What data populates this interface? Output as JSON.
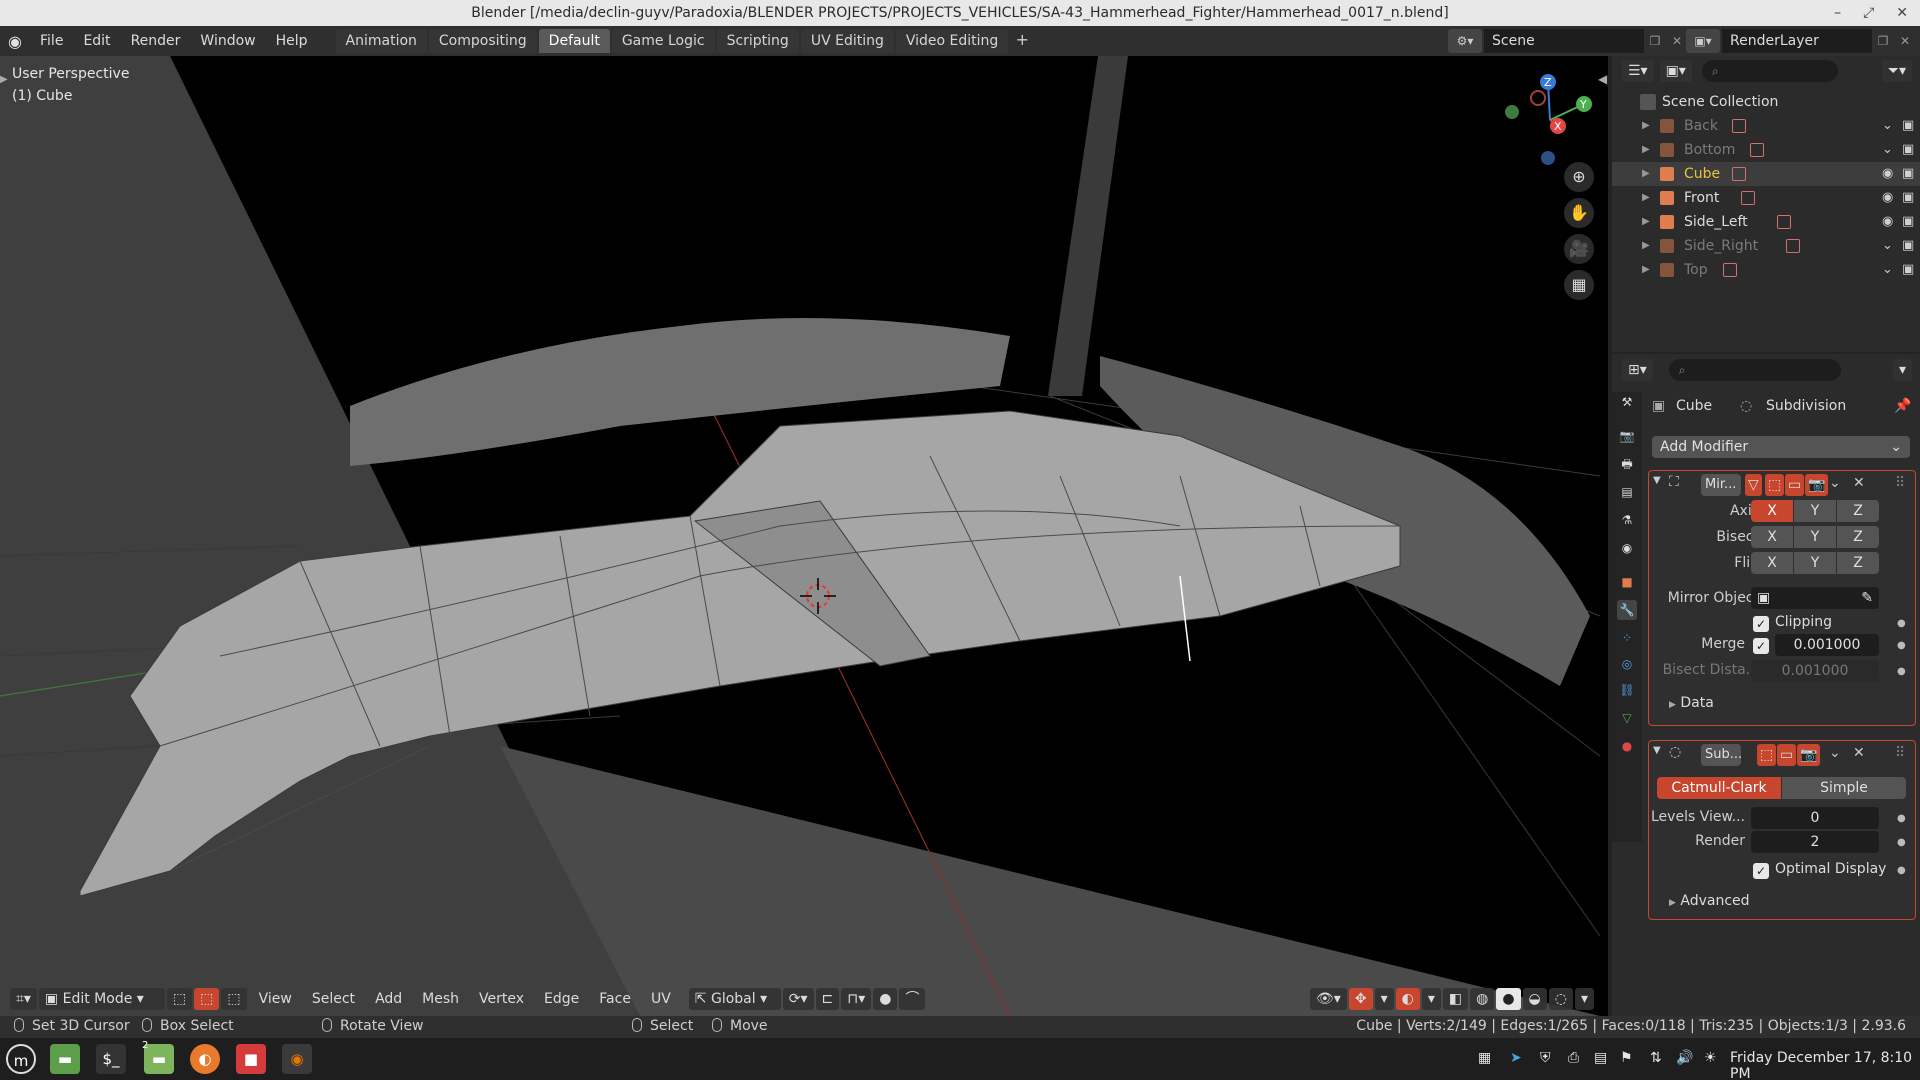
{
  "window": {
    "title": "Blender [/media/declin-guyv/Paradoxia/BLENDER PROJECTS/PROJECTS_VEHICLES/SA-43_Hammerhead_Fighter/Hammerhead_0017_n.blend]",
    "controls": [
      "–",
      "⤢",
      "✕"
    ]
  },
  "menu": [
    "File",
    "Edit",
    "Render",
    "Window",
    "Help"
  ],
  "workspaces": [
    {
      "label": "Animation",
      "active": false
    },
    {
      "label": "Compositing",
      "active": false
    },
    {
      "label": "Default",
      "active": true
    },
    {
      "label": "Game Logic",
      "active": false
    },
    {
      "label": "Scripting",
      "active": false
    },
    {
      "label": "UV Editing",
      "active": false
    },
    {
      "label": "Video Editing",
      "active": false
    }
  ],
  "scene": {
    "name": "Scene"
  },
  "render_layer": {
    "name": "RenderLayer"
  },
  "viewport": {
    "perspective": "User Perspective",
    "object": "(1) Cube",
    "gizmo": {
      "x": "X",
      "y": "Y",
      "z": "Z"
    }
  },
  "vp_header": {
    "mode": "Edit Mode",
    "menus": [
      "View",
      "Select",
      "Add",
      "Mesh",
      "Vertex",
      "Edge",
      "Face",
      "UV"
    ],
    "orientation": "Global"
  },
  "status": {
    "left": [
      "Set 3D Cursor",
      "Box Select",
      "Rotate View",
      "Select",
      "Move"
    ],
    "stats": "Cube | Verts:2/149 | Edges:1/265 | Faces:0/118 | Tris:235 | Objects:1/3 | 2.93.6"
  },
  "outliner": {
    "root": "Scene Collection",
    "items": [
      {
        "name": "Back",
        "visible": false,
        "selected": false,
        "color": "#7a7a7a"
      },
      {
        "name": "Bottom",
        "visible": false,
        "selected": false,
        "color": "#7a7a7a"
      },
      {
        "name": "Cube",
        "visible": true,
        "selected": true,
        "color": "#e8c33a"
      },
      {
        "name": "Front",
        "visible": true,
        "selected": false,
        "color": "#dcdcdc"
      },
      {
        "name": "Side_Left",
        "visible": true,
        "selected": false,
        "color": "#dcdcdc"
      },
      {
        "name": "Side_Right",
        "visible": false,
        "selected": false,
        "color": "#7a7a7a"
      },
      {
        "name": "Top",
        "visible": false,
        "selected": false,
        "color": "#7a7a7a"
      }
    ]
  },
  "properties": {
    "object": "Cube",
    "modifier_tab": "Subdivision",
    "add_modifier": "Add Modifier",
    "mirror": {
      "name": "Mir...",
      "axis_label": "Axis",
      "bisect_label": "Bisect",
      "flip_label": "Flip",
      "axes": [
        "X",
        "Y",
        "Z"
      ],
      "axis_on": [
        true,
        false,
        false
      ],
      "mirror_object_label": "Mirror Object",
      "clipping_label": "Clipping",
      "clipping": true,
      "merge_label": "Merge",
      "merge": true,
      "merge_value": "0.001000",
      "bisect_dist_label": "Bisect Dista...",
      "bisect_dist_value": "0.001000",
      "data_label": "Data"
    },
    "subsurf": {
      "name": "Sub...",
      "catmull": "Catmull-Clark",
      "simple": "Simple",
      "levels_label": "Levels View...",
      "levels_value": "0",
      "render_label": "Render",
      "render_value": "2",
      "optimal_label": "Optimal Display",
      "optimal": true,
      "advanced_label": "Advanced"
    }
  },
  "taskbar": {
    "clock": "Friday December 17, 8:10 PM",
    "workspace_badge": "2"
  },
  "colors": {
    "accent": "#c8452e",
    "selected_text": "#e8c33a"
  }
}
